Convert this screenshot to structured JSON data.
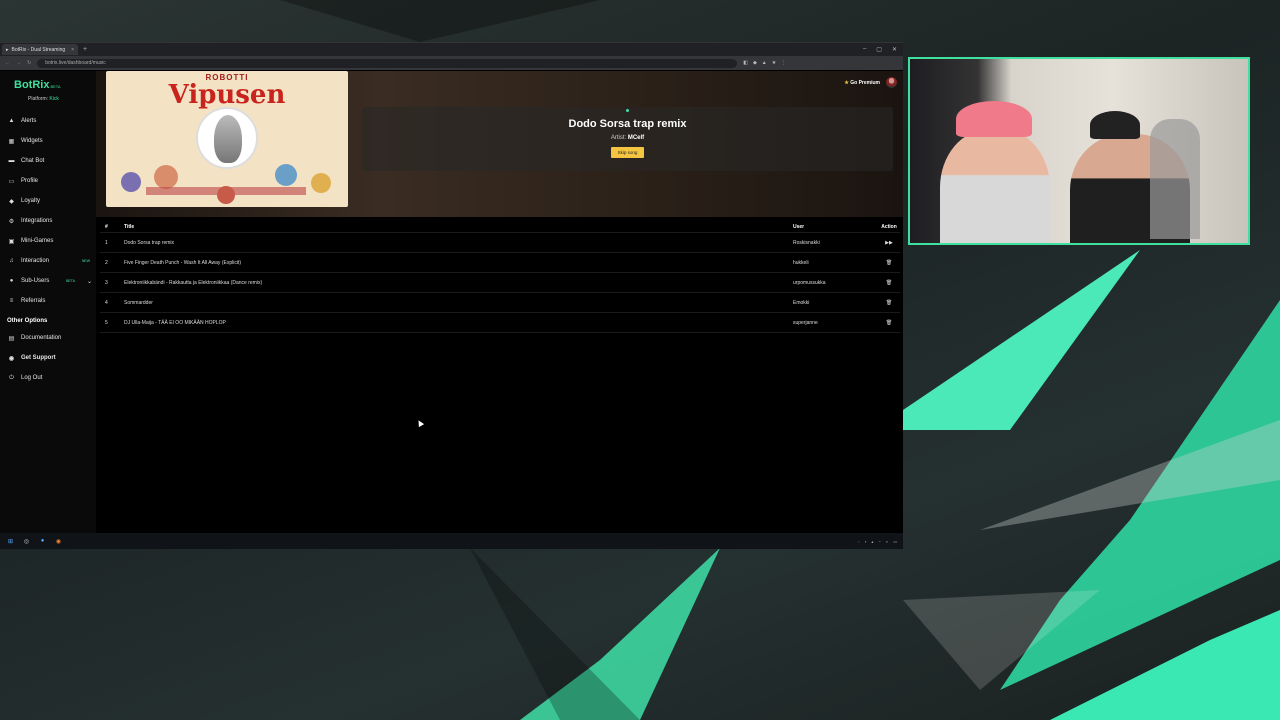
{
  "browser": {
    "tab_title": "BotRix - Dual Streaming",
    "url": "botrix.live/dashboard/music"
  },
  "app": {
    "brand": "BotRix",
    "brand_badge": "BETA",
    "platform_label": "Platform:",
    "platform_value": "Kick",
    "go_premium": "Go Premium"
  },
  "sidebar": {
    "items": [
      {
        "label": "Alerts",
        "icon": "alert-icon"
      },
      {
        "label": "Widgets",
        "icon": "widgets-icon"
      },
      {
        "label": "Chat Bot",
        "icon": "chat-icon"
      },
      {
        "label": "Profile",
        "icon": "profile-icon"
      },
      {
        "label": "Loyalty",
        "icon": "loyalty-icon"
      },
      {
        "label": "Integrations",
        "icon": "integrations-icon"
      },
      {
        "label": "Mini-Games",
        "icon": "games-icon"
      },
      {
        "label": "Interaction",
        "icon": "music-icon",
        "badge": "NEW"
      },
      {
        "label": "Sub-Users",
        "icon": "users-icon",
        "badge": "BETA"
      },
      {
        "label": "Referrals",
        "icon": "referrals-icon"
      }
    ],
    "other_title": "Other Options",
    "other_items": [
      {
        "label": "Documentation",
        "icon": "doc-icon"
      },
      {
        "label": "Get Support",
        "icon": "support-icon"
      },
      {
        "label": "Log Out",
        "icon": "logout-icon"
      }
    ]
  },
  "now_playing": {
    "cover_line1": "ROBOTTI",
    "cover_line2": "Vipusen",
    "title": "Dodo Sorsa trap remix",
    "artist_label": "Artist:",
    "artist": "MCelf",
    "skip_label": "Skip song"
  },
  "queue": {
    "headers": {
      "num": "#",
      "title": "Title",
      "user": "User",
      "action": "Action"
    },
    "rows": [
      {
        "num": "1",
        "title": "Dodo Sorsa trap remix",
        "user": "Roskisnakki",
        "action": "play"
      },
      {
        "num": "2",
        "title": "Five Finger Death Punch - Wash It All Away (Explicit)",
        "user": "hukkeli",
        "action": "delete"
      },
      {
        "num": "3",
        "title": "Elektroniikkabändi - Rakkautta ja Elektroniikkaa (Dance remix)",
        "user": "urpomussukka",
        "action": "delete"
      },
      {
        "num": "4",
        "title": "Sommardder",
        "user": "Emokki",
        "action": "delete"
      },
      {
        "num": "5",
        "title": "DJ Ulla-Maija - TÄÄ EI OO MIKÄÄN HOPLOP",
        "user": "superjanne",
        "action": "delete"
      }
    ]
  },
  "colors": {
    "accent": "#3fe0a0",
    "skip_button": "#f5c542"
  }
}
